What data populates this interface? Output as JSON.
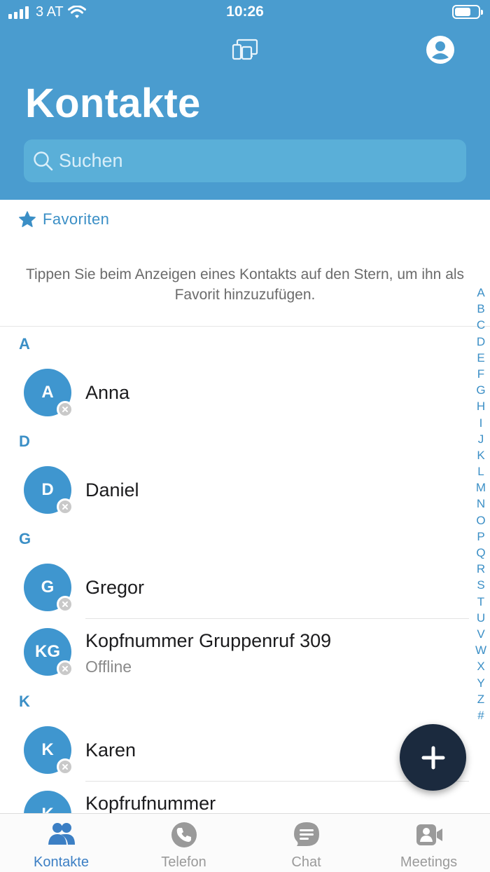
{
  "status_bar": {
    "carrier": "3 AT",
    "time": "10:26"
  },
  "header": {
    "title": "Kontakte",
    "devices_icon": "devices-icon",
    "account_icon": "account-icon"
  },
  "search": {
    "placeholder": "Suchen",
    "value": ""
  },
  "favorites": {
    "label": "Favoriten",
    "hint": "Tippen Sie beim Anzeigen eines Kontakts auf den Stern, um ihn als Favorit hinzuzufügen."
  },
  "sections": [
    {
      "letter": "A",
      "contacts": [
        {
          "initials": "A",
          "name": "Anna",
          "status": ""
        }
      ]
    },
    {
      "letter": "D",
      "contacts": [
        {
          "initials": "D",
          "name": "Daniel",
          "status": ""
        }
      ]
    },
    {
      "letter": "G",
      "contacts": [
        {
          "initials": "G",
          "name": "Gregor",
          "status": ""
        },
        {
          "initials": "KG",
          "name": "Kopfnummer Gruppenruf 309",
          "status": "Offline"
        }
      ]
    },
    {
      "letter": "K",
      "contacts": [
        {
          "initials": "K",
          "name": "Karen",
          "status": ""
        },
        {
          "initials": "K",
          "name": "Kopfrufnummer",
          "status": ""
        }
      ]
    }
  ],
  "alphabet_index": [
    "A",
    "B",
    "C",
    "D",
    "E",
    "F",
    "G",
    "H",
    "I",
    "J",
    "K",
    "L",
    "M",
    "N",
    "O",
    "P",
    "Q",
    "R",
    "S",
    "T",
    "U",
    "V",
    "W",
    "X",
    "Y",
    "Z",
    "#"
  ],
  "fab": {
    "icon": "plus-icon"
  },
  "tabs": [
    {
      "label": "Kontakte",
      "icon": "contacts-icon",
      "active": true
    },
    {
      "label": "Telefon",
      "icon": "phone-icon",
      "active": false
    },
    {
      "label": "Chat",
      "icon": "chat-icon",
      "active": false
    },
    {
      "label": "Meetings",
      "icon": "meetings-icon",
      "active": false
    }
  ],
  "colors": {
    "header_bg": "#4a9ccf",
    "accent": "#3b8fc6",
    "avatar": "#3f96cf",
    "fab": "#1b2a3e",
    "active_tab": "#3c7fc4",
    "inactive_tab": "#9a9a9a"
  }
}
